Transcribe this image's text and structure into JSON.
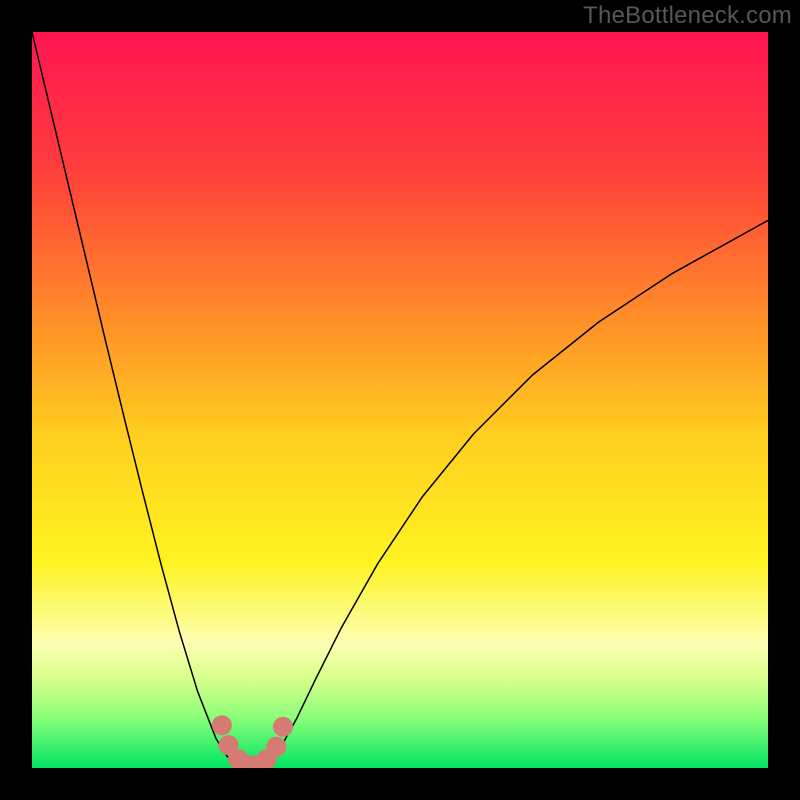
{
  "watermark": "TheBottleneck.com",
  "chart_data": {
    "type": "line",
    "title": "",
    "xlabel": "",
    "ylabel": "",
    "xlim": [
      0,
      100
    ],
    "ylim": [
      0,
      100
    ],
    "grid": false,
    "legend": false,
    "background_gradient": {
      "direction": "vertical",
      "stops": [
        {
          "pos": 0.0,
          "color": "#ff1552"
        },
        {
          "pos": 0.18,
          "color": "#ff3c3c"
        },
        {
          "pos": 0.38,
          "color": "#ff8a29"
        },
        {
          "pos": 0.55,
          "color": "#ffcf1f"
        },
        {
          "pos": 0.72,
          "color": "#fff321"
        },
        {
          "pos": 0.83,
          "color": "#fdffb2"
        },
        {
          "pos": 0.88,
          "color": "#d6ff8a"
        },
        {
          "pos": 0.93,
          "color": "#8dff7a"
        },
        {
          "pos": 1.0,
          "color": "#00e562"
        }
      ]
    },
    "series": [
      {
        "name": "bottleneck-curve",
        "color": "#000000",
        "stroke_width": 1.5,
        "x": [
          0.0,
          2.5,
          5.0,
          7.5,
          10.0,
          12.5,
          15.0,
          17.5,
          20.0,
          22.5,
          25.0,
          26.5,
          28.0,
          29.0,
          29.7,
          30.5,
          31.5,
          32.5,
          34.0,
          36.0,
          38.5,
          42.0,
          47.0,
          53.0,
          60.0,
          68.0,
          77.0,
          87.0,
          100.0
        ],
        "y": [
          100.0,
          89.5,
          79.0,
          68.5,
          58.0,
          47.7,
          37.6,
          27.8,
          18.6,
          10.4,
          4.0,
          1.6,
          0.3,
          0.0,
          0.0,
          0.0,
          0.3,
          1.2,
          3.2,
          6.8,
          12.0,
          19.0,
          27.8,
          36.8,
          45.4,
          53.4,
          60.6,
          67.2,
          74.4
        ]
      }
    ],
    "markers": {
      "color": "#d67a74",
      "radius": 10,
      "points": [
        {
          "x": 25.8,
          "y": 5.8
        },
        {
          "x": 26.7,
          "y": 3.1
        },
        {
          "x": 28.0,
          "y": 1.2
        },
        {
          "x": 29.3,
          "y": 0.4
        },
        {
          "x": 30.6,
          "y": 0.4
        },
        {
          "x": 31.9,
          "y": 1.2
        },
        {
          "x": 33.2,
          "y": 2.9
        },
        {
          "x": 34.1,
          "y": 5.6
        }
      ]
    }
  }
}
